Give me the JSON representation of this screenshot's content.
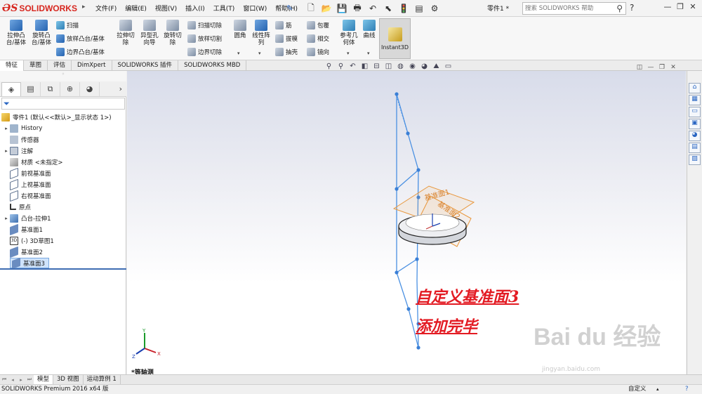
{
  "app": {
    "logo_ds": "ƏS",
    "logo_name": "SOLIDWORKS",
    "menus": [
      "文件(F)",
      "编辑(E)",
      "视图(V)",
      "插入(I)",
      "工具(T)",
      "窗口(W)",
      "帮助(H)"
    ],
    "part_name": "零件1 *",
    "help_search_placeholder": "搜索 SOLIDWORKS 帮助"
  },
  "ribbon": {
    "extrude_boss": "拉伸凸\n台/基体",
    "revolve_boss": "旋转凸\n台/基体",
    "sweep": "扫描",
    "loft_boss": "放样凸台/基体",
    "boundary_boss": "边界凸台/基体",
    "extrude_cut": "拉伸切\n除",
    "hole_wizard": "异型孔\n向导",
    "revolve_cut": "旋转切\n除",
    "swept_cut": "扫描切除",
    "lofted_cut": "放样切割",
    "boundary_cut": "边界切除",
    "fillet": "圆角",
    "linear_pattern": "线性阵\n列",
    "rib": "筋",
    "draft": "拔模",
    "shell": "抽壳",
    "wrap": "包覆",
    "intersect": "相交",
    "mirror": "镜向",
    "ref_geometry": "参考几\n何体",
    "curves": "曲线",
    "instant3d": "Instant3D"
  },
  "command_tabs": [
    "特征",
    "草图",
    "评估",
    "DimXpert",
    "SOLIDWORKS 插件",
    "SOLIDWORKS MBD"
  ],
  "tree": {
    "root": "零件1 (默认<<默认>_显示状态 1>)",
    "items": [
      "History",
      "传感器",
      "注解",
      "材质 <未指定>",
      "前视基准面",
      "上视基准面",
      "右视基准面",
      "原点",
      "凸台-拉伸1",
      "基准面1",
      "(-) 3D草图1",
      "基准面2",
      "基准面3"
    ]
  },
  "graphics": {
    "view_label": "*等轴测",
    "annotation_line1": "自定义基准面3",
    "annotation_line2": "添加完毕",
    "plane_label_1": "基准面1",
    "plane_label_2": "基准面2",
    "watermark": "Bai du 经验",
    "watermark_url": "jingyan.baidu.com",
    "triad_x": "X",
    "triad_y": "Y",
    "triad_z": "Z"
  },
  "bottom_tabs": [
    "模型",
    "3D 视图",
    "运动算例 1"
  ],
  "status": {
    "product": "SOLIDWORKS Premium 2016 x64 版",
    "units": "自定义"
  },
  "colors": {
    "brand_red": "#d7261e",
    "annotation_red": "#e31b23",
    "sketch_blue": "#4a90e2",
    "plane_orange": "#e8963a"
  }
}
